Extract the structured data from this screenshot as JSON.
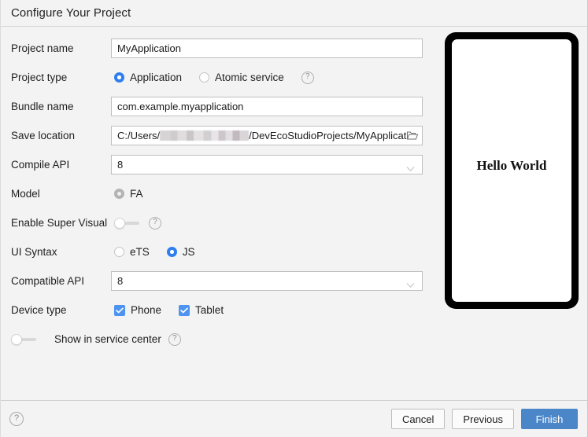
{
  "dialog": {
    "title": "Configure Your Project"
  },
  "form": {
    "project_name": {
      "label": "Project name",
      "value": "MyApplication",
      "placeholder": "Project name"
    },
    "project_type": {
      "label": "Project type",
      "options": [
        {
          "label": "Application",
          "selected": true
        },
        {
          "label": "Atomic service",
          "selected": false
        }
      ],
      "help": "?"
    },
    "bundle_name": {
      "label": "Bundle name",
      "value": "com.example.myapplication",
      "placeholder": "Bundle name"
    },
    "save_location": {
      "label": "Save location",
      "value_prefix": "C:/Users/",
      "value_suffix": "/DevEcoStudioProjects/MyApplicat",
      "redacted": true,
      "browse_icon": "folder-icon"
    },
    "compile_api": {
      "label": "Compile API",
      "value": "8",
      "chevron": "chevron-down-icon"
    },
    "model": {
      "label": "Model",
      "options": [
        {
          "label": "FA",
          "selected": true,
          "disabled": true
        }
      ]
    },
    "super_visual": {
      "label": "Enable Super Visual",
      "toggle_on": false,
      "help": "?"
    },
    "ui_syntax": {
      "label": "UI Syntax",
      "options": [
        {
          "label": "eTS",
          "selected": false
        },
        {
          "label": "JS",
          "selected": true
        }
      ]
    },
    "compatible_api": {
      "label": "Compatible API",
      "value": "8",
      "chevron": "chevron-down-icon"
    },
    "device_type": {
      "label": "Device type",
      "options": [
        {
          "label": "Phone",
          "checked": true
        },
        {
          "label": "Tablet",
          "checked": true
        }
      ]
    },
    "service_center": {
      "label": "Show in service center",
      "toggle_on": false,
      "help": "?"
    }
  },
  "preview": {
    "text": "Hello World"
  },
  "footer": {
    "help": "?",
    "cancel_label": "Cancel",
    "previous_label": "Previous",
    "finish_label": "Finish"
  },
  "colors": {
    "accent_blue": "#2e7ef0",
    "checkbox_blue": "#4d94f0",
    "primary_button": "#4a86c8",
    "background": "#f3f3f3",
    "disabled_radio": "#b3b3b3"
  }
}
